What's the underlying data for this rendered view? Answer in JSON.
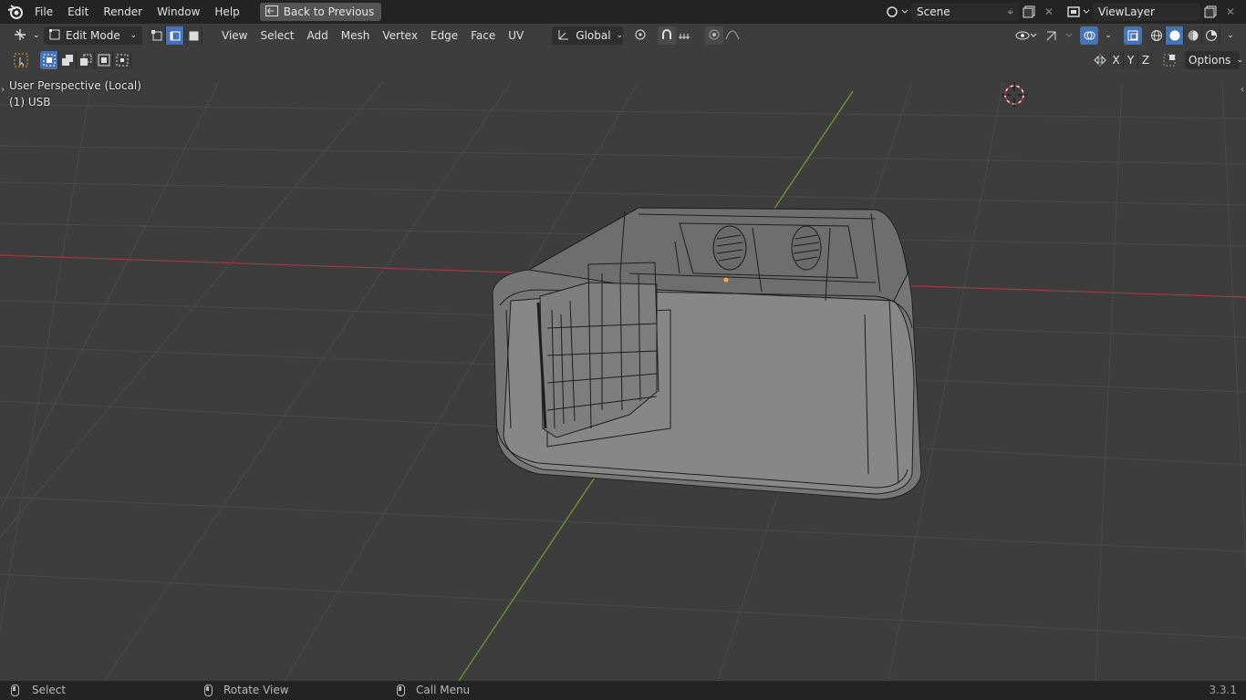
{
  "topbar": {
    "menus": [
      "File",
      "Edit",
      "Render",
      "Window",
      "Help"
    ],
    "back_label": "Back to Previous",
    "scene_label": "Scene",
    "viewlayer_label": "ViewLayer"
  },
  "header": {
    "mode_label": "Edit Mode",
    "menus": [
      "View",
      "Select",
      "Add",
      "Mesh",
      "Vertex",
      "Edge",
      "Face",
      "UV"
    ],
    "orientation_label": "Global",
    "axes": [
      "X",
      "Y",
      "Z"
    ],
    "options_label": "Options"
  },
  "viewport": {
    "perspective_label": "User Perspective (Local)",
    "object_label": "(1) USB"
  },
  "status": {
    "select_label": "Select",
    "rotate_label": "Rotate View",
    "call_menu_label": "Call Menu",
    "version": "3.3.1"
  },
  "colors": {
    "active_blue": "#4772b3",
    "x_axis": "#b04048",
    "y_axis": "#7aa33a",
    "viewport_bg": "#3d3d3d"
  }
}
